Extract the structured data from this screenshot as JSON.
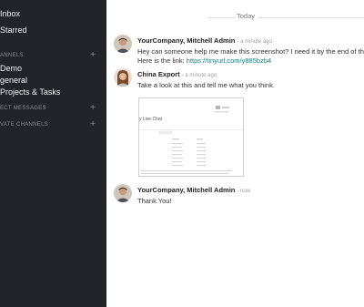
{
  "sidebar": {
    "inbox": "Inbox",
    "starred": "Starred",
    "channels_title": "ANNELS",
    "channels": [
      "Demo",
      "general",
      "Projects & Tasks"
    ],
    "direct_title": "ECT MESSAGES",
    "private_title": "VATE CHANNELS"
  },
  "thread": {
    "date_label": "Today",
    "messages": [
      {
        "author": "YourCompany, Mitchell Admin",
        "time": "- a minute ago",
        "line1": "Hey can someone help me make this screenshot? I need it by the end of the da",
        "line2_prefix": "Here is the link: ",
        "line2_link": "https://tinyurl.com/y885bzb4"
      },
      {
        "author": "China Export",
        "time": "- a minute ago",
        "line1": "Take a look at this and tell me what you think.",
        "attachment_title": "y Live Chat"
      },
      {
        "author": "YourCompany, Mitchell Admin",
        "time": "- now",
        "line1": "Thank You!"
      }
    ]
  }
}
